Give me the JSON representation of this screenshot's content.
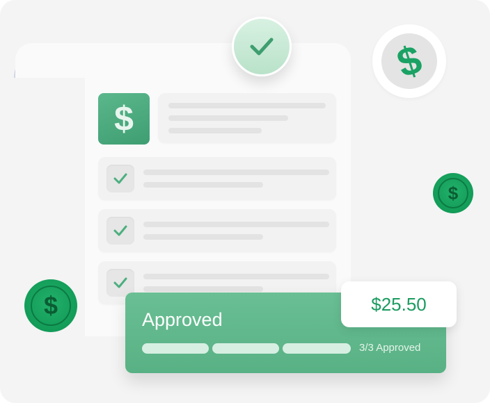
{
  "receipt": {
    "currency_symbol": "$",
    "status_label": "Approved",
    "progress": {
      "completed": 3,
      "total": 3,
      "text": "3/3 Approved"
    },
    "amount": "$25.50",
    "checklist_count": 3
  },
  "coins": {
    "symbol": "$"
  },
  "colors": {
    "background": "#f4f4f4",
    "accent_green": "#5fb88a",
    "coin_green": "#16a05e",
    "amount_text": "#1b9b60"
  },
  "icons": [
    "dollar-icon",
    "check-icon",
    "coin-dollar-icon"
  ]
}
